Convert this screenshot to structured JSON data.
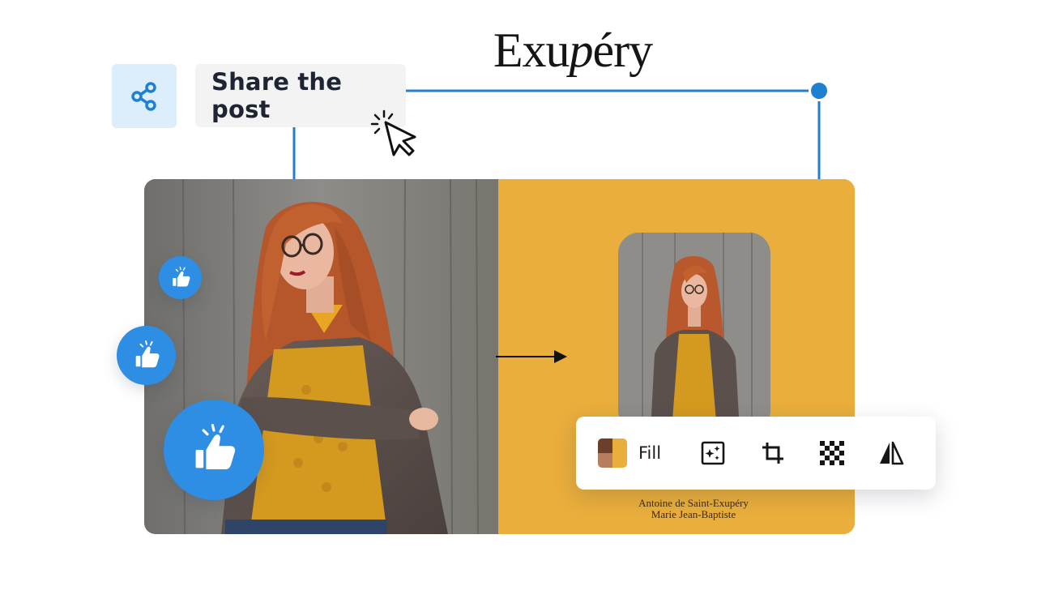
{
  "share": {
    "label": "Share the post",
    "icon": "share-icon",
    "tile_color": "#dcedfb",
    "accent": "#1f7fd1"
  },
  "card": {
    "book_title_plain": "Exu",
    "book_title_italic": "p",
    "book_title_rest": "éry",
    "authors": [
      "Antoine de Saint-Exupéry",
      "Marie Jean-Baptiste"
    ],
    "panel_color": "#e9ae3c"
  },
  "likes": {
    "icon": "thumbs-up-icon",
    "color": "#2e8ee3"
  },
  "toolbar": {
    "fill_label": "Fill",
    "swatch_colors": [
      "#6b3f2a",
      "#e9ae3c",
      "#b87d5c",
      "#e9ae3c"
    ],
    "tools": [
      {
        "name": "magic-enhance-icon"
      },
      {
        "name": "crop-icon"
      },
      {
        "name": "transparency-icon"
      },
      {
        "name": "flip-icon"
      }
    ]
  }
}
